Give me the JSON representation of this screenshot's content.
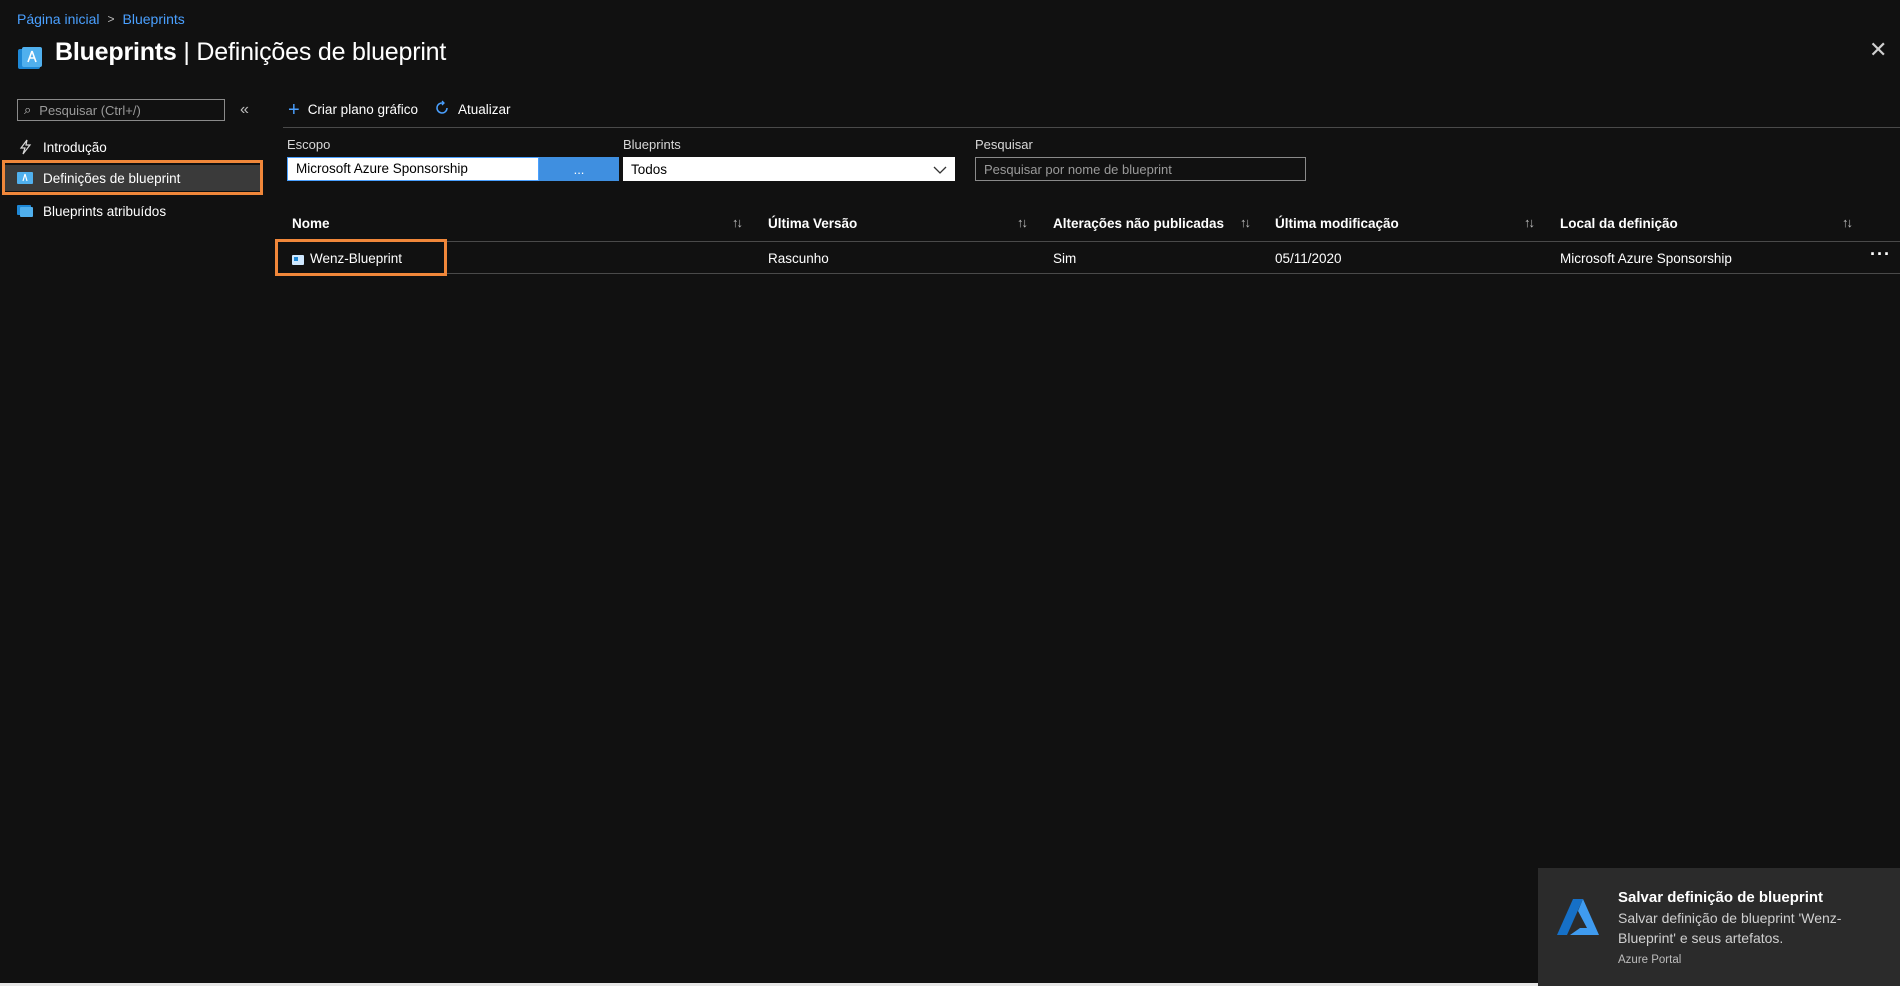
{
  "breadcrumb": {
    "home": "Página inicial",
    "current": "Blueprints"
  },
  "header": {
    "title_bold": "Blueprints",
    "title_rest": " | Definições de blueprint",
    "icon": "blueprint-icon"
  },
  "nav": {
    "search_placeholder": "Pesquisar (Ctrl+/)",
    "items": [
      {
        "label": "Introdução",
        "icon": "lightning-icon"
      },
      {
        "label": "Definições de blueprint",
        "icon": "blueprint-icon",
        "selected": true
      },
      {
        "label": "Blueprints atribuídos",
        "icon": "assigned-blueprint-icon"
      }
    ]
  },
  "toolbar": {
    "create_label": "Criar plano gráfico",
    "refresh_label": "Atualizar"
  },
  "filters": {
    "scope_label": "Escopo",
    "scope_value": "Microsoft Azure Sponsorship",
    "scope_button": "...",
    "blueprints_label": "Blueprints",
    "blueprints_value": "Todos",
    "search_label": "Pesquisar",
    "search_placeholder": "Pesquisar por nome de blueprint"
  },
  "table": {
    "columns": [
      "Nome",
      "Última Versão",
      "Alterações não publicadas",
      "Última modificação",
      "Local da definição"
    ],
    "rows": [
      {
        "name": "Wenz-Blueprint",
        "version": "Rascunho",
        "unpublished": "Sim",
        "modified": "05/11/2020",
        "location": "Microsoft Azure Sponsorship"
      }
    ]
  },
  "toast": {
    "title": "Salvar definição de blueprint",
    "body": "Salvar definição de blueprint 'Wenz-Blueprint' e seus artefatos.",
    "source": "Azure Portal"
  },
  "colors": {
    "accent": "#4aa0ff",
    "highlight": "#f0873a",
    "background": "#111111"
  }
}
